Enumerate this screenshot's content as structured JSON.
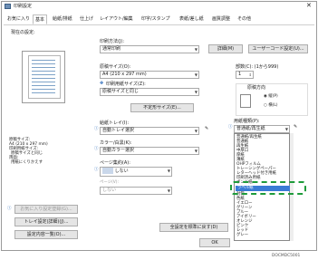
{
  "window": {
    "title": "印刷設定"
  },
  "tabs": [
    "お気に入り",
    "基本",
    "給紙/排紙",
    "仕上げ",
    "レイアウト/編集",
    "印字/スタンプ",
    "表紙/差し紙",
    "画質調整",
    "その他"
  ],
  "left": {
    "current_settings_label": "現在の設定:",
    "summary": [
      "原稿サイズ:",
      "A4 (210 x 297 mm)",
      "印刷用紙サイズ:",
      "原稿サイズと同じ",
      "両面:",
      "用紙にくりかえす"
    ],
    "register_button": "お気に入り設定登録(G)...",
    "tray_button": "トレイ設定(詳細)(J)...",
    "list_button": "設定内容一覧(O)..."
  },
  "job": {
    "type_label": "印刷方法(J):",
    "type_value": "通常印刷",
    "detail_button": "詳細(M)",
    "user_code_button": "ユーザーコード設定(U)..."
  },
  "paper": {
    "size_label": "原稿サイズ(O):",
    "size_value": "A4 (210 x 297 mm)",
    "print_size_label": "印刷用紙サイズ(Z):",
    "print_size_value": "原稿サイズと同じ",
    "custom_button": "不定形サイズ(E)..."
  },
  "copies": {
    "label": "部数(C): (1から999)",
    "value": "1"
  },
  "orientation": {
    "label": "原稿方向",
    "portrait": "縦(P)",
    "landscape": "横(L)"
  },
  "tray": {
    "label": "給紙トレイ(I):",
    "value": "自動トレイ選択"
  },
  "color": {
    "label": "カラー/白黒(K):",
    "value": "自動カラー選択"
  },
  "duplex": {
    "label": "ページ集約(A):",
    "value": "しない",
    "pages_label": "ページ(V):",
    "pages_value": "しない"
  },
  "paper_type": {
    "label": "用紙種類(P):",
    "value": "普通紙/再生紙",
    "options": [
      "普通紙/再生紙",
      "普通紙",
      "再生紙",
      "中厚口",
      "厚紙",
      "薄紙",
      "OHPフィルム",
      "トレーシングペーパー",
      "レターヘッド付き用紙",
      "印刷済み用紙",
      "ボンド紙",
      "ラベル紙",
      "封筒",
      "色紙",
      "イエロー",
      "グリーン",
      "ブルー",
      "アイボリー",
      "オレンジ",
      "ピンク",
      "レッド",
      "グレー",
      "コート紙：光沢与制可用紙"
    ],
    "highlighted": "ラベル紙"
  },
  "bottom": {
    "default_button": "全設定を標準に戻す(D)",
    "ok_button": "OK"
  },
  "caption": "DOCMDC5001"
}
